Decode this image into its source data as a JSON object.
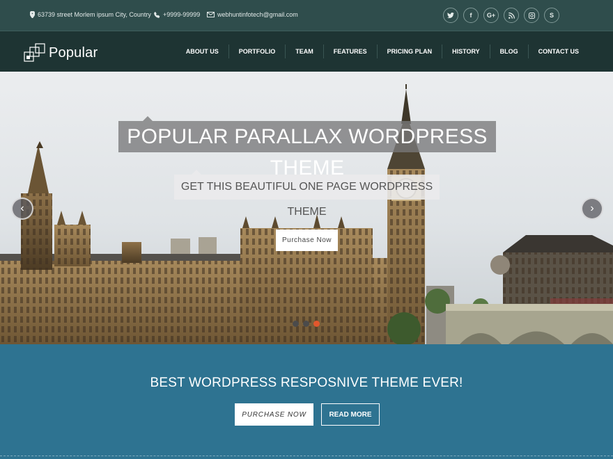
{
  "topbar": {
    "address": "63739 street Morlem ipsum City, Country",
    "phone": "+9999-99999",
    "email": "webhuntinfotech@gmail.com",
    "social": [
      {
        "icon": "twitter-icon",
        "glyph": "t"
      },
      {
        "icon": "facebook-icon",
        "glyph": "f"
      },
      {
        "icon": "google-plus-icon",
        "glyph": "G+"
      },
      {
        "icon": "rss-icon",
        "glyph": "rss"
      },
      {
        "icon": "instagram-icon",
        "glyph": "ig"
      },
      {
        "icon": "skype-icon",
        "glyph": "S"
      }
    ]
  },
  "nav": {
    "logo_text": "Popular",
    "items": [
      "ABOUT US",
      "PORTFOLIO",
      "TEAM",
      "FEATURES",
      "PRICING PLAN",
      "HISTORY",
      "BLOG",
      "CONTACT US"
    ]
  },
  "hero": {
    "title": "POPULAR PARALLAX WORDPRESS THEME",
    "subtitle": "GET THIS BEAUTIFUL ONE PAGE WORDPRESS THEME",
    "button": "Purchase Now",
    "prev_glyph": "‹",
    "next_glyph": "›",
    "slides_total": 3,
    "active_slide": 3
  },
  "cta": {
    "title": "BEST WORDPRESS RESPOSNIVE THEME EVER!",
    "primary_button": "PURCHASE NOW",
    "secondary_button": "READ MORE"
  },
  "colors": {
    "topbar_bg": "#2f4d4c",
    "nav_bg": "#1e3433",
    "cta_bg": "#2e7391",
    "active_dot": "#e2572d"
  }
}
